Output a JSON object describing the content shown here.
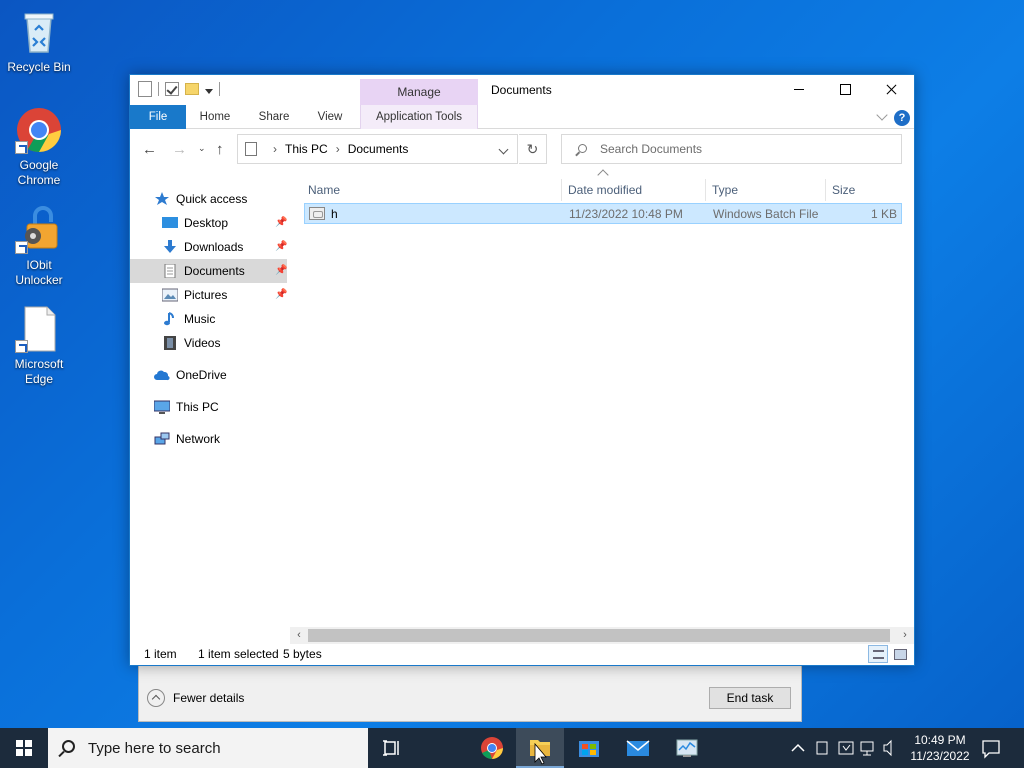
{
  "desktop": {
    "icons": [
      {
        "label": "Recycle Bin"
      },
      {
        "label": "Google Chrome"
      },
      {
        "label": "IObit Unlocker"
      },
      {
        "label": "Microsoft Edge"
      }
    ]
  },
  "window": {
    "title": "Documents",
    "context_tab": "Manage",
    "ribbon_tabs": [
      "File",
      "Home",
      "Share",
      "View",
      "Application Tools"
    ],
    "breadcrumb": [
      "This PC",
      "Documents"
    ],
    "search_placeholder": "Search Documents",
    "nav": {
      "quick_access": "Quick access",
      "items": [
        {
          "label": "Desktop",
          "pinned": true
        },
        {
          "label": "Downloads",
          "pinned": true
        },
        {
          "label": "Documents",
          "pinned": true,
          "selected": true
        },
        {
          "label": "Pictures",
          "pinned": true
        },
        {
          "label": "Music",
          "pinned": false
        },
        {
          "label": "Videos",
          "pinned": false
        }
      ],
      "onedrive": "OneDrive",
      "this_pc": "This PC",
      "network": "Network"
    },
    "columns": [
      "Name",
      "Date modified",
      "Type",
      "Size"
    ],
    "files": [
      {
        "name": "h",
        "date": "11/23/2022 10:48 PM",
        "type": "Windows Batch File",
        "size": "1 KB",
        "selected": true
      }
    ],
    "status": {
      "count": "1 item",
      "selected": "1 item selected",
      "size": "5 bytes"
    }
  },
  "task_manager": {
    "fewer_details": "Fewer details",
    "end_task": "End task"
  },
  "taskbar": {
    "search_placeholder": "Type here to search",
    "clock_time": "10:49 PM",
    "clock_date": "11/23/2022"
  },
  "colors": {
    "accent": "#1979ca",
    "selection": "#cce8ff",
    "taskbar": "#1c2b3c"
  }
}
